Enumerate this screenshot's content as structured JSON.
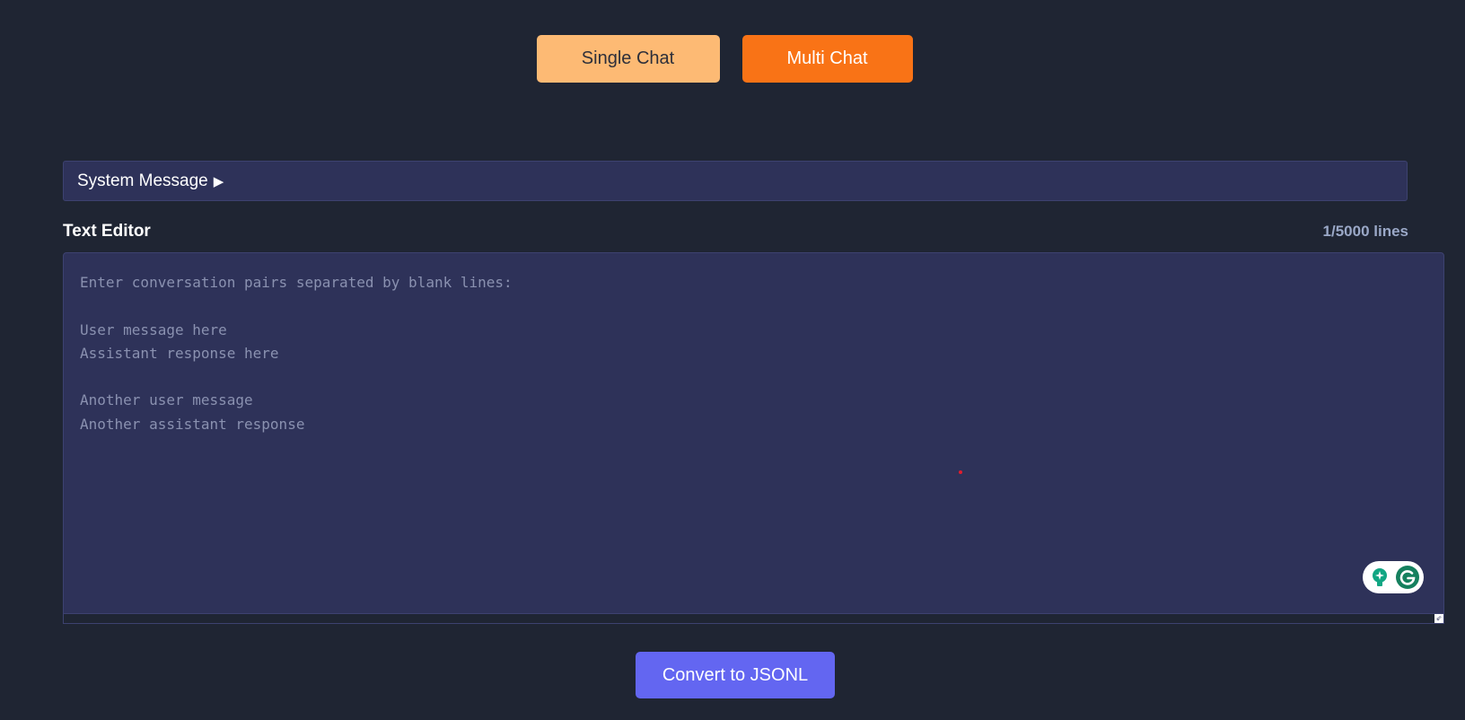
{
  "mode_buttons": {
    "single_label": "Single Chat",
    "multi_label": "Multi Chat",
    "active": "Multi Chat"
  },
  "system_message": {
    "label": "System Message",
    "toggle_icon": "triangle-right-icon"
  },
  "editor": {
    "title": "Text Editor",
    "line_count": "1/5000 lines",
    "value": "",
    "placeholder": "Enter conversation pairs separated by blank lines:\n\nUser message here\nAssistant response here\n\nAnother user message\nAnother assistant response"
  },
  "grammarly": {
    "suggestion_icon": "lightbulb-icon",
    "logo_icon": "grammarly-g-icon"
  },
  "convert_button": {
    "label": "Convert to JSONL"
  },
  "colors": {
    "background": "#1f2533",
    "panel": "#2e3259",
    "single_chat": "#fdba74",
    "multi_chat": "#f97316",
    "convert": "#6366f1",
    "grammarly_green": "#11a683"
  }
}
